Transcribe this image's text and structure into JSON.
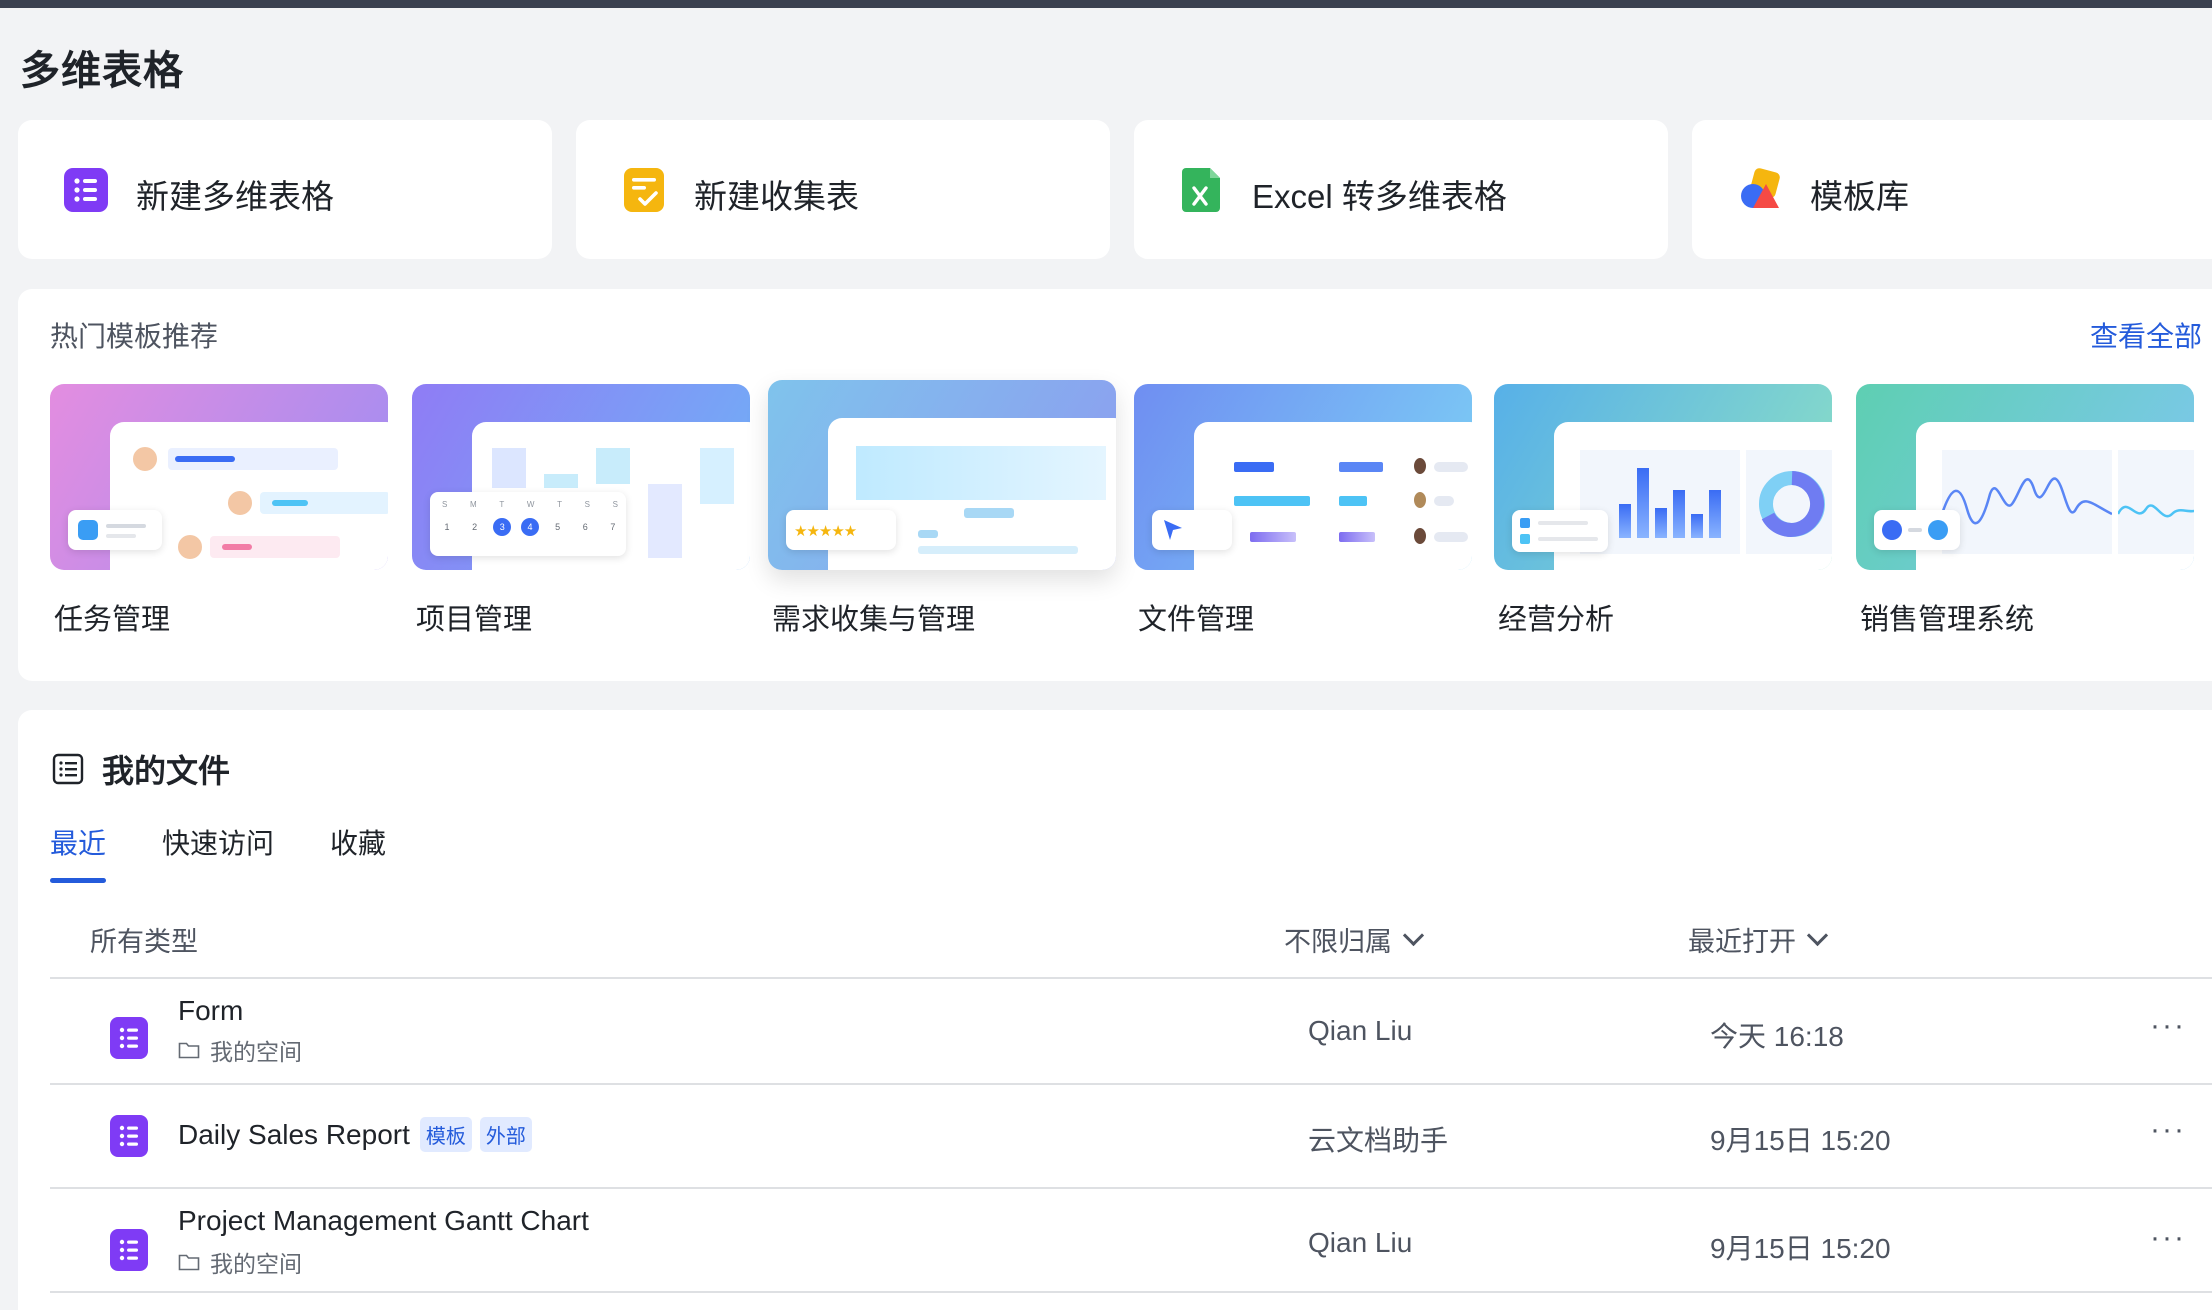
{
  "page": {
    "title": "多维表格"
  },
  "quick_actions": [
    {
      "label": "新建多维表格",
      "icon": "bitable-icon"
    },
    {
      "label": "新建收集表",
      "icon": "form-icon"
    },
    {
      "label": "Excel 转多维表格",
      "icon": "excel-icon"
    },
    {
      "label": "模板库",
      "icon": "template-library-icon"
    }
  ],
  "hot_templates": {
    "title": "热门模板推荐",
    "view_all": "查看全部",
    "items": [
      {
        "label": "任务管理"
      },
      {
        "label": "项目管理"
      },
      {
        "label": "需求收集与管理"
      },
      {
        "label": "文件管理"
      },
      {
        "label": "经营分析"
      },
      {
        "label": "销售管理系统"
      }
    ],
    "thumb_calendar": {
      "days_head": [
        "S",
        "M",
        "T",
        "W",
        "T",
        "S",
        "S"
      ],
      "days": [
        "1",
        "2",
        "3",
        "4",
        "5",
        "6",
        "7"
      ]
    }
  },
  "my_files": {
    "title": "我的文件",
    "tabs": [
      {
        "label": "最近",
        "active": true
      },
      {
        "label": "快速访问",
        "active": false
      },
      {
        "label": "收藏",
        "active": false
      }
    ],
    "filters": {
      "type": "所有类型",
      "owner": "不限归属",
      "sort": "最近打开"
    },
    "rows": [
      {
        "name": "Form",
        "location": "我的空间",
        "tags": [],
        "owner": "Qian Liu",
        "time": "今天 16:18",
        "more": "···"
      },
      {
        "name": "Daily Sales Report",
        "location": "",
        "tags": [
          "模板",
          "外部"
        ],
        "owner": "云文档助手",
        "time": "9月15日 15:20",
        "more": "···"
      },
      {
        "name": "Project Management Gantt Chart",
        "location": "我的空间",
        "tags": [],
        "owner": "Qian Liu",
        "time": "9月15日 15:20",
        "more": "···"
      }
    ]
  },
  "colors": {
    "accent": "#245bdb",
    "bitable": "#7f3bf5",
    "form": "#f5b60f",
    "excel": "#34b45c"
  }
}
